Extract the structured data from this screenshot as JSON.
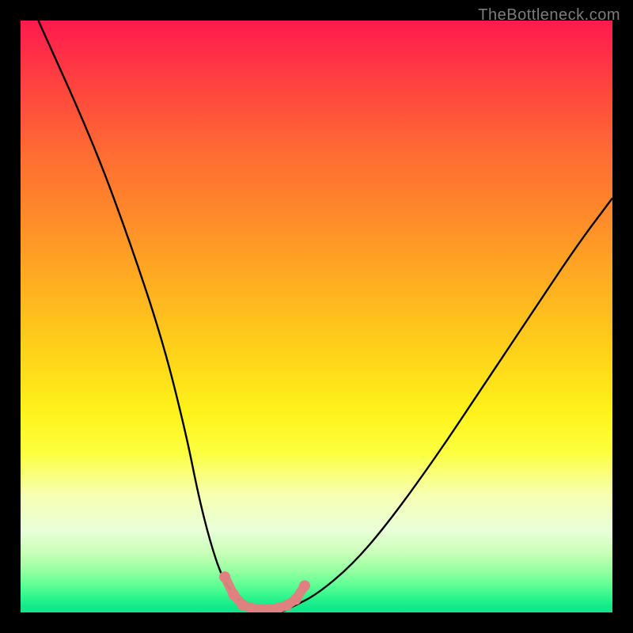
{
  "watermark": "TheBottleneck.com",
  "chart_data": {
    "type": "line",
    "title": "",
    "xlabel": "",
    "ylabel": "",
    "xlim": [
      0,
      100
    ],
    "ylim": [
      0,
      100
    ],
    "series": [
      {
        "name": "bottleneck-curve",
        "x": [
          3,
          12,
          18,
          24,
          28,
          30,
          32,
          34,
          36,
          38,
          40,
          42,
          44,
          46,
          50,
          56,
          62,
          70,
          78,
          86,
          94,
          100
        ],
        "y": [
          100,
          80,
          64,
          46,
          30,
          20,
          12,
          6,
          3,
          1,
          0,
          0,
          0,
          1,
          3,
          8,
          15,
          26,
          38,
          50,
          62,
          70
        ],
        "color": "#000000"
      }
    ],
    "markers": {
      "name": "highlight-dots",
      "color": "#e08080",
      "points": [
        {
          "x": 34.5,
          "y": 6
        },
        {
          "x": 36,
          "y": 3
        },
        {
          "x": 37.5,
          "y": 1.3
        },
        {
          "x": 39,
          "y": 0.7
        },
        {
          "x": 40.5,
          "y": 0.5
        },
        {
          "x": 42,
          "y": 0.5
        },
        {
          "x": 43.5,
          "y": 0.7
        },
        {
          "x": 45,
          "y": 1.2
        },
        {
          "x": 46.5,
          "y": 2.2
        },
        {
          "x": 48,
          "y": 4.5
        }
      ]
    }
  }
}
